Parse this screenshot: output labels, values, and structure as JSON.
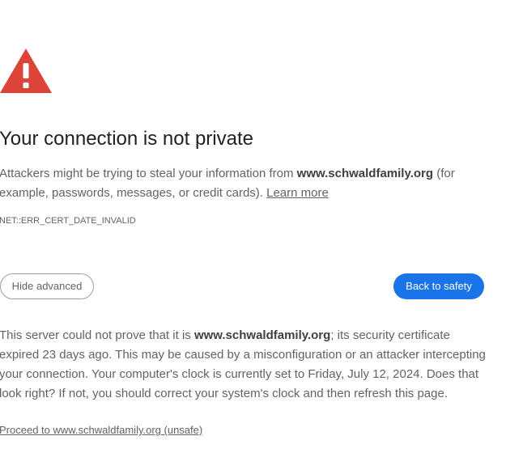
{
  "colors": {
    "warning_red": "#db4437",
    "primary_blue": "#1a73e8",
    "title_text": "#202124",
    "body_text": "#5f6368"
  },
  "icon": {
    "name": "warning-triangle-icon"
  },
  "title": "Your connection is not private",
  "summary": {
    "text_before": "Attackers might be trying to steal your information from ",
    "domain": "www.schwaldfamily.org",
    "text_after": " (for example, passwords, messages, or credit cards). ",
    "learn_more": "Learn more"
  },
  "error_code": "NET::ERR_CERT_DATE_INVALID",
  "buttons": {
    "hide_advanced": "Hide advanced",
    "back_to_safety": "Back to safety"
  },
  "details": {
    "text_before": "This server could not prove that it is ",
    "domain": "www.schwaldfamily.org",
    "text_after": "; its security certificate expired 23 days ago. This may be caused by a misconfiguration or an attacker intercepting your connection. Your computer's clock is currently set to Friday, July 12, 2024. Does that look right? If not, you should correct your system's clock and then refresh this page."
  },
  "proceed_link": "Proceed to www.schwaldfamily.org (unsafe)"
}
